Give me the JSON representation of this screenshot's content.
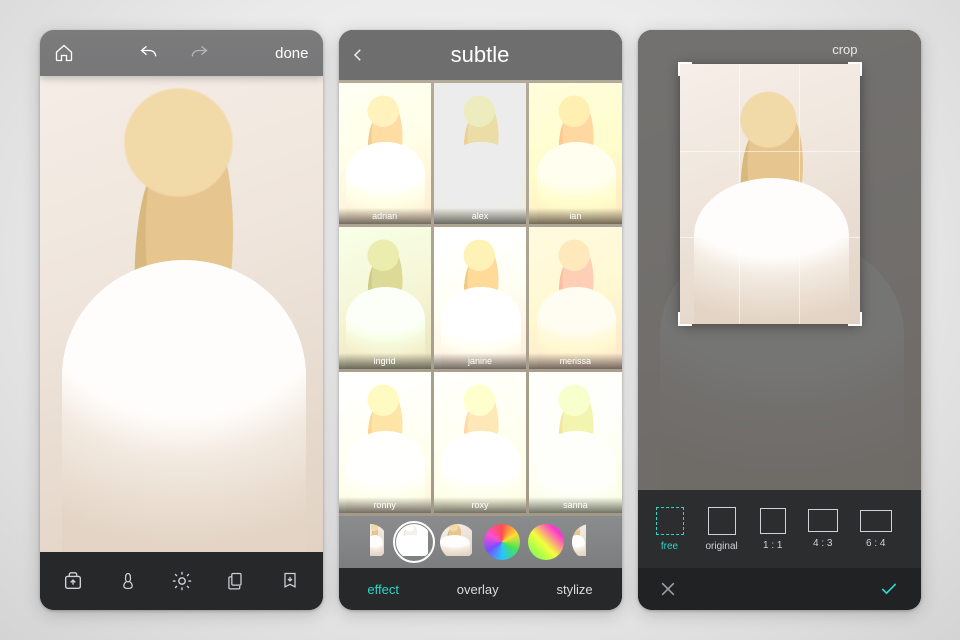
{
  "screen1": {
    "done_label": "done",
    "tools": [
      "open",
      "brush",
      "adjust",
      "layers",
      "save"
    ]
  },
  "screen2": {
    "title": "subtle",
    "filters": [
      {
        "name": "adrian",
        "tint": "t-adrian"
      },
      {
        "name": "alex",
        "tint": "t-alex"
      },
      {
        "name": "ian",
        "tint": "t-ian"
      },
      {
        "name": "ingrid",
        "tint": "t-ingrid"
      },
      {
        "name": "janine",
        "tint": "t-janine"
      },
      {
        "name": "merissa",
        "tint": "t-merissa"
      },
      {
        "name": "ronny",
        "tint": "t-ronny"
      },
      {
        "name": "roxy",
        "tint": "t-roxy"
      },
      {
        "name": "sanna",
        "tint": "t-sanna"
      }
    ],
    "tabs": {
      "effect": "effect",
      "overlay": "overlay",
      "stylize": "stylize"
    },
    "active_tab": "effect"
  },
  "screen3": {
    "crop_label": "crop",
    "ratios": [
      {
        "key": "free",
        "label": "free"
      },
      {
        "key": "original",
        "label": "original"
      },
      {
        "key": "1:1",
        "label": "1 : 1"
      },
      {
        "key": "4:3",
        "label": "4 : 3"
      },
      {
        "key": "6:4",
        "label": "6 : 4"
      }
    ],
    "active_ratio": "free"
  },
  "colors": {
    "accent": "#29d6c6"
  }
}
